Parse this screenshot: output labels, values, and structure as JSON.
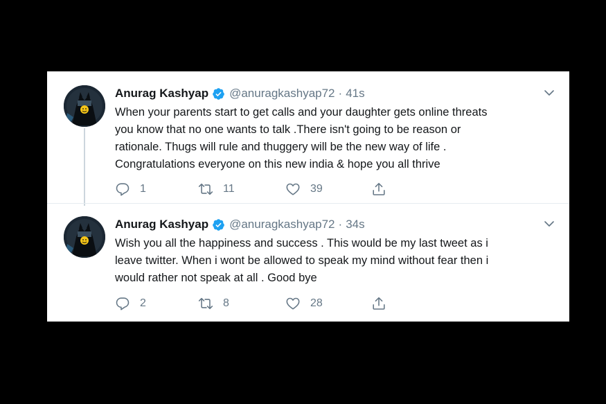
{
  "tweets": [
    {
      "name": "Anurag Kashyap",
      "handle": "@anuragkashyap72",
      "separator": "·",
      "time": "41s",
      "lines": [
        "When your parents start to get calls and your daughter gets online threats",
        "you know that no one wants to talk .There isn't going to be reason or",
        "rationale. Thugs will rule and thuggery will be the new way of life .",
        "Congratulations everyone on this new india & hope you all thrive"
      ],
      "replies": "1",
      "retweets": "11",
      "likes": "39"
    },
    {
      "name": "Anurag Kashyap",
      "handle": "@anuragkashyap72",
      "separator": "·",
      "time": "34s",
      "lines": [
        "Wish you all the happiness and success . This would be my last tweet as i",
        "leave twitter. When i wont be allowed to speak my mind without fear then i",
        "would rather not speak at all . Good bye"
      ],
      "replies": "2",
      "retweets": "8",
      "likes": "28"
    }
  ],
  "icons": {
    "verified": "verified-badge-icon",
    "caret": "chevron-down-icon",
    "reply": "reply-icon",
    "retweet": "retweet-icon",
    "like": "heart-icon",
    "share": "share-icon"
  },
  "colors": {
    "verified": "#1da1f2",
    "secondary_text": "#657786",
    "primary_text": "#14171a",
    "background": "#000000",
    "card": "#ffffff"
  }
}
